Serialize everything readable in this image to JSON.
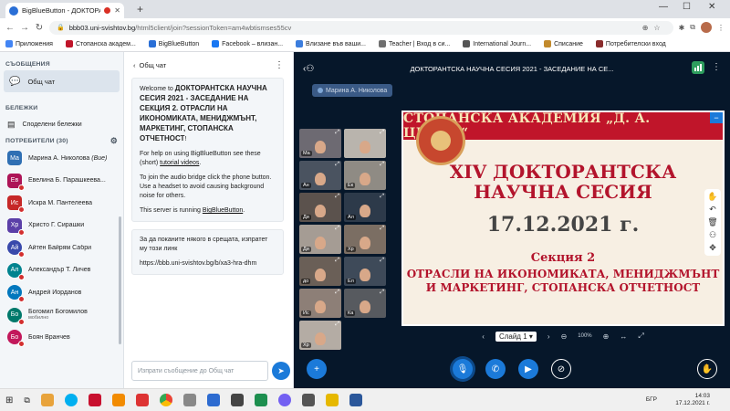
{
  "browser": {
    "tab_title": "BigBlueButton - ДОКТОРАН",
    "url_host": "bbb03.uni-svishtov.bg",
    "url_path": "/html5client/join?sessionToken=am4wbtismses55cv"
  },
  "bookmarks": [
    {
      "label": "Приложения",
      "color": "#4285f4"
    },
    {
      "label": "Стопанска академ...",
      "color": "#c0152a"
    },
    {
      "label": "BigBlueButton",
      "color": "#2a6fd6"
    },
    {
      "label": "Facebook – влизан...",
      "color": "#1877f2"
    },
    {
      "label": "Влизане във ваши...",
      "color": "#3b7ddd"
    },
    {
      "label": "Teacher | Вход в си...",
      "color": "#6f6f6f"
    },
    {
      "label": "International Journ...",
      "color": "#555555"
    },
    {
      "label": "Списание",
      "color": "#c28a2c"
    },
    {
      "label": "Потребителски вход",
      "color": "#8a2c2c"
    }
  ],
  "sidebar": {
    "messages_header": "СЪОБЩЕНИЯ",
    "public_chat": "Общ чат",
    "notes_header": "БЕЛЕЖКИ",
    "shared_notes": "Споделени бележки",
    "users_header": "ПОТРЕБИТЕЛИ (30)",
    "users": [
      {
        "initials": "Ма",
        "name": "Марина А. Николова",
        "suffix": " (Вие)",
        "color": "#2f6fb3",
        "shape": "square",
        "sub": ""
      },
      {
        "initials": "Ев",
        "name": "Евелина Б. Парашкеева...",
        "suffix": "",
        "color": "#ad1457",
        "shape": "square",
        "sub": ""
      },
      {
        "initials": "Ис",
        "name": "Искра М. Пантелеева",
        "suffix": "",
        "color": "#c62828",
        "shape": "square",
        "sub": ""
      },
      {
        "initials": "Хр",
        "name": "Христо Г. Сирашки",
        "suffix": "",
        "color": "#5b3fa8",
        "shape": "square",
        "sub": ""
      },
      {
        "initials": "Ай",
        "name": "Айтен Байрям Сабри",
        "suffix": "",
        "color": "#3949ab",
        "shape": "round",
        "sub": ""
      },
      {
        "initials": "Ал",
        "name": "Александър Т. Личев",
        "suffix": "",
        "color": "#00838f",
        "shape": "round",
        "sub": ""
      },
      {
        "initials": "Ан",
        "name": "Андрей Йорданов",
        "suffix": "",
        "color": "#0277bd",
        "shape": "round",
        "sub": ""
      },
      {
        "initials": "Бо",
        "name": "Богомил Богомилов",
        "suffix": "",
        "color": "#00796b",
        "shape": "round",
        "sub": "мобилно"
      },
      {
        "initials": "Бо",
        "name": "Боян Вранчев",
        "suffix": "",
        "color": "#c2185b",
        "shape": "round",
        "sub": ""
      }
    ]
  },
  "chat": {
    "back_label": "Общ чат",
    "welcome_prefix": "Welcome to ",
    "welcome_title": "ДОКТОРАНТСКА НАУЧНА СЕСИЯ 2021 - ЗАСЕДАНИЕ НА СЕКЦИЯ 2. ОТРАСЛИ НА ИКОНОМИКАТА, МЕНИДЖМЪНТ, МАРКЕТИНГ, СТОПАНСКА ОТЧЕТНОСТ",
    "welcome_suffix": "!",
    "help_text": "For help on using BigBlueButton see these (short) ",
    "help_link": "tutorial videos",
    "help_end": ".",
    "audio_text": "To join the audio bridge click the phone button. Use a headset to avoid causing background noise for others.",
    "server_text": "This server is running ",
    "server_link": "BigBlueButton",
    "server_end": ".",
    "invite_text": "За да поканите някого в срещата, изпратет му този линк",
    "invite_link": "https://bbb.uni-svishtov.bg/b/xa3-hra-dhm",
    "input_placeholder": "Изпрати съобщение до Общ чат"
  },
  "main": {
    "title": "ДОКТОРАНТСКА НАУЧНА СЕСИЯ 2021 - ЗАСЕДАНИЕ НА СЕ...",
    "talker": "Марина А. Николова",
    "videos": [
      {
        "label": "Ма",
        "bg": "#6d6a72"
      },
      {
        "label": "",
        "bg": "#b9b4ad"
      },
      {
        "label": "Ан",
        "bg": "#4a5360"
      },
      {
        "label": "Ек",
        "bg": "#8f8b84"
      },
      {
        "label": "Ди",
        "bg": "#5b524d"
      },
      {
        "label": "Ал",
        "bg": "#2d3a4a"
      },
      {
        "label": "Ди",
        "bg": "#a59c94"
      },
      {
        "label": "Хр",
        "bg": "#7b6e63"
      },
      {
        "label": "до",
        "bg": "#6a5f57"
      },
      {
        "label": "Ел",
        "bg": "#3e4a59"
      },
      {
        "label": "Ис",
        "bg": "#8d7f77"
      },
      {
        "label": "Ка",
        "bg": "#575a5f"
      },
      {
        "label": "Хр",
        "bg": "#b4aca4"
      }
    ],
    "slide": {
      "header": "СТОПАНСКА АКАДЕМИЯ „Д. А. ЦЕНОВ“",
      "line1": "XIV ДОКТОРАНТСКА",
      "line2": "НАУЧНА СЕСИЯ",
      "date": "17.12.2021 г.",
      "section": "Секция 2",
      "sub1": "ОТРАСЛИ НА ИКОНОМИКАТА, МЕНИДЖМЪНТ",
      "sub2": "И МАРКЕТИНГ, СТОПАНСКА ОТЧЕТНОСТ"
    },
    "slide_label": "Слайд 1",
    "zoom": "100%"
  },
  "taskbar": {
    "lang": "БГР",
    "time": "14:03",
    "date": "17.12.2021 г."
  },
  "colors": {
    "accent": "#1b7ad9",
    "main_bg": "#06172a",
    "slide_red": "#b3142c"
  }
}
